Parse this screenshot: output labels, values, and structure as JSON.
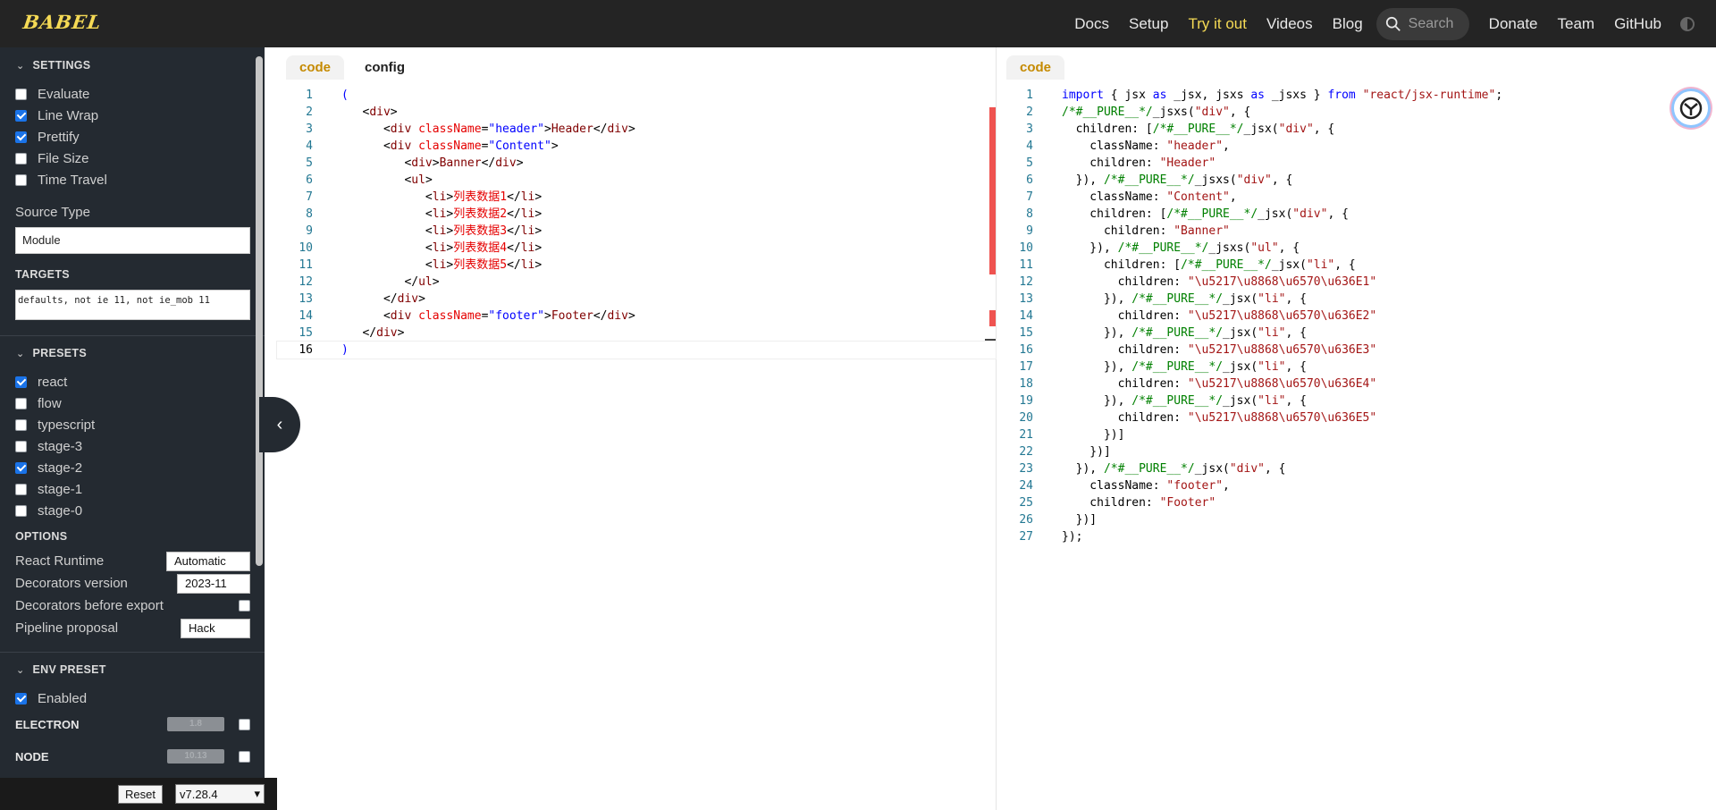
{
  "header": {
    "logo": "BABEL",
    "nav": [
      "Docs",
      "Setup",
      "Try it out",
      "Videos",
      "Blog"
    ],
    "search_placeholder": "Search",
    "nav2": [
      "Donate",
      "Team",
      "GitHub"
    ]
  },
  "sidebar": {
    "settings_title": "SETTINGS",
    "settings": [
      {
        "label": "Evaluate",
        "checked": false
      },
      {
        "label": "Line Wrap",
        "checked": true
      },
      {
        "label": "Prettify",
        "checked": true
      },
      {
        "label": "File Size",
        "checked": false
      },
      {
        "label": "Time Travel",
        "checked": false
      }
    ],
    "source_type_label": "Source Type",
    "source_type_value": "Module",
    "targets_label": "TARGETS",
    "targets_value": "defaults, not ie 11, not ie_mob 11",
    "presets_title": "PRESETS",
    "presets": [
      {
        "label": "react",
        "checked": true
      },
      {
        "label": "flow",
        "checked": false
      },
      {
        "label": "typescript",
        "checked": false
      },
      {
        "label": "stage-3",
        "checked": false
      },
      {
        "label": "stage-2",
        "checked": true
      },
      {
        "label": "stage-1",
        "checked": false
      },
      {
        "label": "stage-0",
        "checked": false
      }
    ],
    "options_title": "OPTIONS",
    "options": [
      {
        "label": "React Runtime",
        "value": "Automatic"
      },
      {
        "label": "Decorators version",
        "value": "2023-11"
      },
      {
        "label": "Decorators before export",
        "value": ""
      },
      {
        "label": "Pipeline proposal",
        "value": "Hack"
      }
    ],
    "env_title": "ENV PRESET",
    "env_enabled": "Enabled",
    "electron_label": "ELECTRON",
    "electron_value": "1.8",
    "node_label": "NODE",
    "node_value": "10.13",
    "reset_label": "Reset",
    "version": "v7.28.4"
  },
  "left_panel": {
    "tabs": [
      "code",
      "config"
    ]
  },
  "right_panel": {
    "tabs": [
      "code"
    ]
  }
}
